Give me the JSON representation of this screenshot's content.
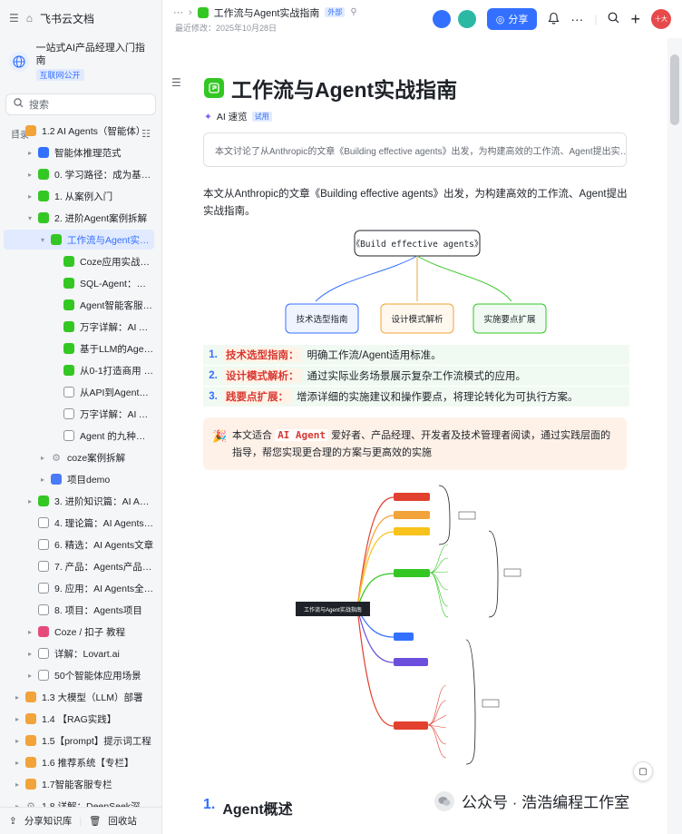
{
  "sidebar": {
    "app_name": "飞书云文档",
    "kb_title": "一站式AI产品经理入门指南",
    "kb_tag": "互联网公开",
    "search_label": "搜索",
    "toc_label": "目录",
    "tree": [
      {
        "label": "1.2 AI Agents（智能体）",
        "depth": 0,
        "arrow": "▾",
        "color": "#f2a33a",
        "icon": "folder"
      },
      {
        "label": "智能体推理范式",
        "depth": 1,
        "arrow": "▸",
        "color": "#3370ff",
        "icon": "doc"
      },
      {
        "label": "0. 学习路径：成为基于A…",
        "depth": 1,
        "arrow": "▸",
        "color": "#34c724",
        "icon": "doc"
      },
      {
        "label": "1. 从案例入门",
        "depth": 1,
        "arrow": "▸",
        "color": "#34c724",
        "icon": "doc"
      },
      {
        "label": "2. 进阶Agent案例拆解",
        "depth": 1,
        "arrow": "▾",
        "color": "#34c724",
        "icon": "doc"
      },
      {
        "label": "工作流与Agent实战…",
        "depth": 2,
        "arrow": "▾",
        "color": "#34c724",
        "icon": "doc",
        "active": true
      },
      {
        "label": "Coze应用实战指南",
        "depth": 3,
        "arrow": "",
        "color": "#34c724",
        "icon": "doc"
      },
      {
        "label": "SQL-Agent：实现…",
        "depth": 3,
        "arrow": "",
        "color": "#34c724",
        "icon": "doc"
      },
      {
        "label": "Agent智能客服…",
        "depth": 3,
        "arrow": "",
        "color": "#34c724",
        "icon": "doc"
      },
      {
        "label": "万字详解：AI Ag…",
        "depth": 3,
        "arrow": "",
        "color": "#34c724",
        "icon": "doc"
      },
      {
        "label": "基于LLM的Agent…",
        "depth": 3,
        "arrow": "",
        "color": "#34c724",
        "icon": "doc"
      },
      {
        "label": "从0-1打造商用 A…",
        "depth": 3,
        "arrow": "",
        "color": "#34c724",
        "icon": "doc"
      },
      {
        "label": "从API到Agent：…",
        "depth": 3,
        "arrow": "",
        "color": "#8f959e",
        "icon": "page"
      },
      {
        "label": "万字详解：AI Ag…",
        "depth": 3,
        "arrow": "",
        "color": "#8f959e",
        "icon": "page"
      },
      {
        "label": "Agent 的九种设…",
        "depth": 3,
        "arrow": "",
        "color": "#8f959e",
        "icon": "page"
      },
      {
        "label": "coze案例拆解",
        "depth": 2,
        "arrow": "▸",
        "color": "#8f959e",
        "icon": "gear"
      },
      {
        "label": "项目demo",
        "depth": 2,
        "arrow": "▸",
        "color": "#4a7bf7",
        "icon": "cloud"
      },
      {
        "label": "3. 进阶知识篇：AI Agen…",
        "depth": 1,
        "arrow": "▸",
        "color": "#34c724",
        "icon": "doc"
      },
      {
        "label": "4. 理论篇：AI Agents理…",
        "depth": 1,
        "arrow": "",
        "color": "#8f959e",
        "icon": "grid"
      },
      {
        "label": "6. 精选：AI Agents文章",
        "depth": 1,
        "arrow": "",
        "color": "#8f959e",
        "icon": "grid"
      },
      {
        "label": "7. 产品：Agents产品分析",
        "depth": 1,
        "arrow": "",
        "color": "#8f959e",
        "icon": "grid"
      },
      {
        "label": "9. 应用：AI Agents全景图",
        "depth": 1,
        "arrow": "",
        "color": "#8f959e",
        "icon": "grid"
      },
      {
        "label": "8. 项目：Agents项目",
        "depth": 1,
        "arrow": "",
        "color": "#8f959e",
        "icon": "grid"
      },
      {
        "label": "Coze / 扣子 教程",
        "depth": 1,
        "arrow": "▸",
        "color": "#e64a7b",
        "icon": "coze"
      },
      {
        "label": "详解：Lovart.ai",
        "depth": 1,
        "arrow": "▸",
        "color": "#8f959e",
        "icon": "page"
      },
      {
        "label": "50个智能体应用场景",
        "depth": 1,
        "arrow": "▸",
        "color": "#8f959e",
        "icon": "page"
      },
      {
        "label": "1.3 大模型（LLM）部署",
        "depth": 0,
        "arrow": "▸",
        "color": "#f2a33a",
        "icon": "folder"
      },
      {
        "label": "1.4 【RAG实践】",
        "depth": 0,
        "arrow": "▸",
        "color": "#f2a33a",
        "icon": "folder"
      },
      {
        "label": "1.5【prompt】提示词工程",
        "depth": 0,
        "arrow": "▸",
        "color": "#f2a33a",
        "icon": "folder"
      },
      {
        "label": "1.6 推荐系统【专栏】",
        "depth": 0,
        "arrow": "▸",
        "color": "#f2a33a",
        "icon": "folder"
      },
      {
        "label": "1.7智能客服专栏",
        "depth": 0,
        "arrow": "▸",
        "color": "#f2a33a",
        "icon": "folder"
      },
      {
        "label": "1.8 详解：DeepSeek深度推…",
        "depth": 0,
        "arrow": "▸",
        "color": "#8f959e",
        "icon": "gear"
      }
    ],
    "bottom_share": "分享知识库",
    "bottom_trash": "回收站"
  },
  "topbar": {
    "doc_name": "工作流与Agent实战指南",
    "external_badge": "外部",
    "last_modified": "最近修改：2025年10月28日",
    "share_label": "分享",
    "avatar_text": "十大"
  },
  "doc": {
    "title": "工作流与Agent实战指南",
    "ai_label": "AI 速览",
    "ai_tag": "试用",
    "summary": "本文讨论了从Anthropic的文章《Building effective agents》出发，为构建高效的工作流、Agent提出实…",
    "intro": "本文从Anthropic的文章《Building effective agents》出发，为构建高效的工作流、Agent提出实战指南。",
    "flow": {
      "root": "《Build effective agents》",
      "children": [
        "技术选型指南",
        "设计模式解析",
        "实施要点扩展"
      ]
    },
    "list": [
      {
        "num": "1.",
        "key": "技术选型指南：",
        "text": "明确工作流/Agent适用标准。"
      },
      {
        "num": "2.",
        "key": "设计模式解析：",
        "text": "通过实际业务场景展示复杂工作流模式的应用。"
      },
      {
        "num": "3.",
        "key": "践要点扩展：",
        "text": "增添详细的实施建议和操作要点，将理论转化为可执行方案。"
      }
    ],
    "callout": {
      "emoji": "🎉",
      "before": "本文适合",
      "code": "AI Agent",
      "after": "爱好者、产品经理、开发者及技术管理者阅读，通过实践层面的指导，帮您实现更合理的方案与更高效的实施"
    },
    "mindmap_center": "工作流与Agent实战指南",
    "heading2_num": "1.",
    "heading2_text": "Agent概述",
    "watermark": "公众号 · 浩浩编程工作室"
  }
}
